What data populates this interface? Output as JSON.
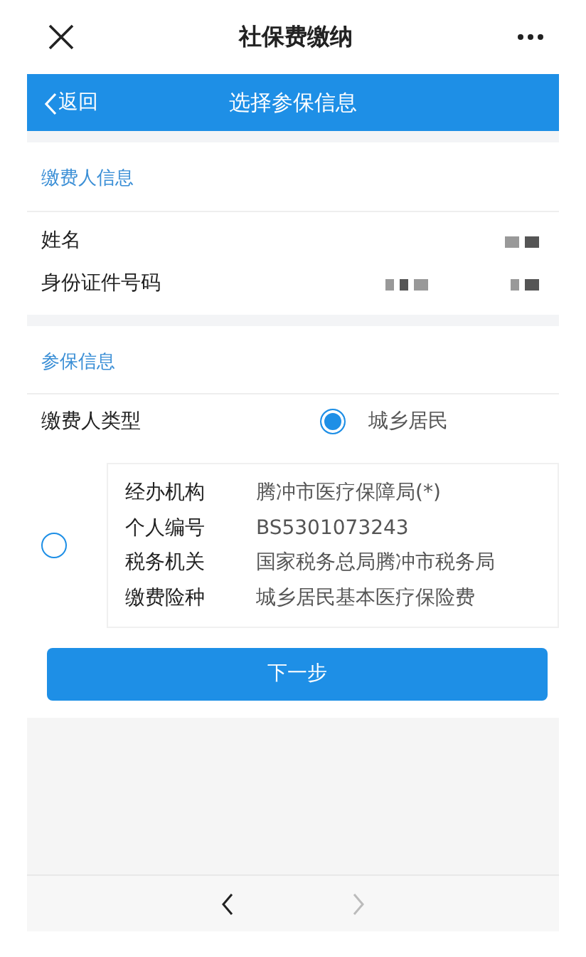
{
  "top_bar": {
    "title": "社保费缴纳"
  },
  "nav_bar": {
    "back": "返回",
    "title": "选择参保信息"
  },
  "payer_section": {
    "title": "缴费人信息",
    "fields": [
      {
        "label": "姓名"
      },
      {
        "label": "身份证件号码"
      }
    ]
  },
  "insurance_section": {
    "title": "参保信息",
    "payer_type": {
      "label": "缴费人类型",
      "option": "城乡居民",
      "selected": true
    },
    "records": [
      {
        "selected": false,
        "fields": [
          {
            "label": "经办机构",
            "value": "腾冲市医疗保障局(*)"
          },
          {
            "label": "个人编号",
            "value": "BS5301073243"
          },
          {
            "label": "税务机关",
            "value": "国家税务总局腾冲市税务局"
          },
          {
            "label": "缴费险种",
            "value": "城乡居民基本医疗保险费"
          }
        ]
      }
    ]
  },
  "next_button": "下一步",
  "browser_nav": {
    "back_disabled": false,
    "forward_disabled": true
  }
}
